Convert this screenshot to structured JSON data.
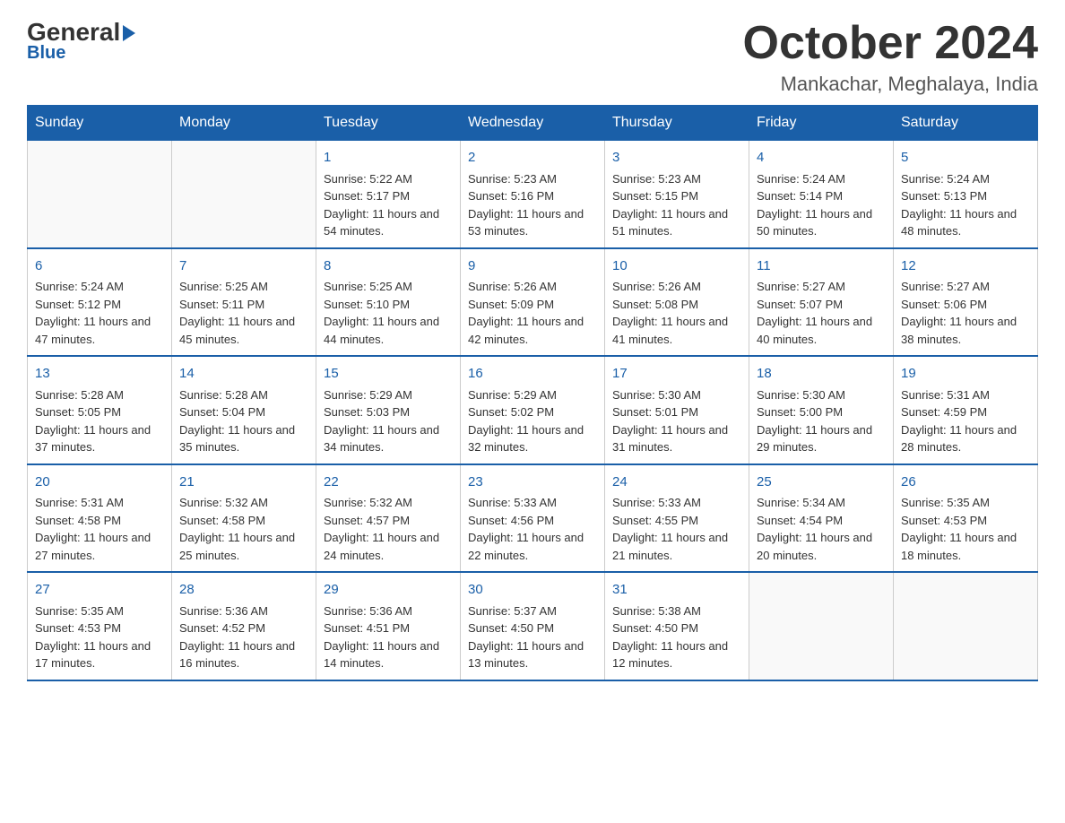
{
  "logo": {
    "general": "General",
    "blue": "Blue",
    "arrow": "▶"
  },
  "header": {
    "month": "October 2024",
    "location": "Mankachar, Meghalaya, India"
  },
  "days_of_week": [
    "Sunday",
    "Monday",
    "Tuesday",
    "Wednesday",
    "Thursday",
    "Friday",
    "Saturday"
  ],
  "weeks": [
    [
      {
        "day": "",
        "info": ""
      },
      {
        "day": "",
        "info": ""
      },
      {
        "day": "1",
        "info": "Sunrise: 5:22 AM\nSunset: 5:17 PM\nDaylight: 11 hours and 54 minutes."
      },
      {
        "day": "2",
        "info": "Sunrise: 5:23 AM\nSunset: 5:16 PM\nDaylight: 11 hours and 53 minutes."
      },
      {
        "day": "3",
        "info": "Sunrise: 5:23 AM\nSunset: 5:15 PM\nDaylight: 11 hours and 51 minutes."
      },
      {
        "day": "4",
        "info": "Sunrise: 5:24 AM\nSunset: 5:14 PM\nDaylight: 11 hours and 50 minutes."
      },
      {
        "day": "5",
        "info": "Sunrise: 5:24 AM\nSunset: 5:13 PM\nDaylight: 11 hours and 48 minutes."
      }
    ],
    [
      {
        "day": "6",
        "info": "Sunrise: 5:24 AM\nSunset: 5:12 PM\nDaylight: 11 hours and 47 minutes."
      },
      {
        "day": "7",
        "info": "Sunrise: 5:25 AM\nSunset: 5:11 PM\nDaylight: 11 hours and 45 minutes."
      },
      {
        "day": "8",
        "info": "Sunrise: 5:25 AM\nSunset: 5:10 PM\nDaylight: 11 hours and 44 minutes."
      },
      {
        "day": "9",
        "info": "Sunrise: 5:26 AM\nSunset: 5:09 PM\nDaylight: 11 hours and 42 minutes."
      },
      {
        "day": "10",
        "info": "Sunrise: 5:26 AM\nSunset: 5:08 PM\nDaylight: 11 hours and 41 minutes."
      },
      {
        "day": "11",
        "info": "Sunrise: 5:27 AM\nSunset: 5:07 PM\nDaylight: 11 hours and 40 minutes."
      },
      {
        "day": "12",
        "info": "Sunrise: 5:27 AM\nSunset: 5:06 PM\nDaylight: 11 hours and 38 minutes."
      }
    ],
    [
      {
        "day": "13",
        "info": "Sunrise: 5:28 AM\nSunset: 5:05 PM\nDaylight: 11 hours and 37 minutes."
      },
      {
        "day": "14",
        "info": "Sunrise: 5:28 AM\nSunset: 5:04 PM\nDaylight: 11 hours and 35 minutes."
      },
      {
        "day": "15",
        "info": "Sunrise: 5:29 AM\nSunset: 5:03 PM\nDaylight: 11 hours and 34 minutes."
      },
      {
        "day": "16",
        "info": "Sunrise: 5:29 AM\nSunset: 5:02 PM\nDaylight: 11 hours and 32 minutes."
      },
      {
        "day": "17",
        "info": "Sunrise: 5:30 AM\nSunset: 5:01 PM\nDaylight: 11 hours and 31 minutes."
      },
      {
        "day": "18",
        "info": "Sunrise: 5:30 AM\nSunset: 5:00 PM\nDaylight: 11 hours and 29 minutes."
      },
      {
        "day": "19",
        "info": "Sunrise: 5:31 AM\nSunset: 4:59 PM\nDaylight: 11 hours and 28 minutes."
      }
    ],
    [
      {
        "day": "20",
        "info": "Sunrise: 5:31 AM\nSunset: 4:58 PM\nDaylight: 11 hours and 27 minutes."
      },
      {
        "day": "21",
        "info": "Sunrise: 5:32 AM\nSunset: 4:58 PM\nDaylight: 11 hours and 25 minutes."
      },
      {
        "day": "22",
        "info": "Sunrise: 5:32 AM\nSunset: 4:57 PM\nDaylight: 11 hours and 24 minutes."
      },
      {
        "day": "23",
        "info": "Sunrise: 5:33 AM\nSunset: 4:56 PM\nDaylight: 11 hours and 22 minutes."
      },
      {
        "day": "24",
        "info": "Sunrise: 5:33 AM\nSunset: 4:55 PM\nDaylight: 11 hours and 21 minutes."
      },
      {
        "day": "25",
        "info": "Sunrise: 5:34 AM\nSunset: 4:54 PM\nDaylight: 11 hours and 20 minutes."
      },
      {
        "day": "26",
        "info": "Sunrise: 5:35 AM\nSunset: 4:53 PM\nDaylight: 11 hours and 18 minutes."
      }
    ],
    [
      {
        "day": "27",
        "info": "Sunrise: 5:35 AM\nSunset: 4:53 PM\nDaylight: 11 hours and 17 minutes."
      },
      {
        "day": "28",
        "info": "Sunrise: 5:36 AM\nSunset: 4:52 PM\nDaylight: 11 hours and 16 minutes."
      },
      {
        "day": "29",
        "info": "Sunrise: 5:36 AM\nSunset: 4:51 PM\nDaylight: 11 hours and 14 minutes."
      },
      {
        "day": "30",
        "info": "Sunrise: 5:37 AM\nSunset: 4:50 PM\nDaylight: 11 hours and 13 minutes."
      },
      {
        "day": "31",
        "info": "Sunrise: 5:38 AM\nSunset: 4:50 PM\nDaylight: 11 hours and 12 minutes."
      },
      {
        "day": "",
        "info": ""
      },
      {
        "day": "",
        "info": ""
      }
    ]
  ]
}
